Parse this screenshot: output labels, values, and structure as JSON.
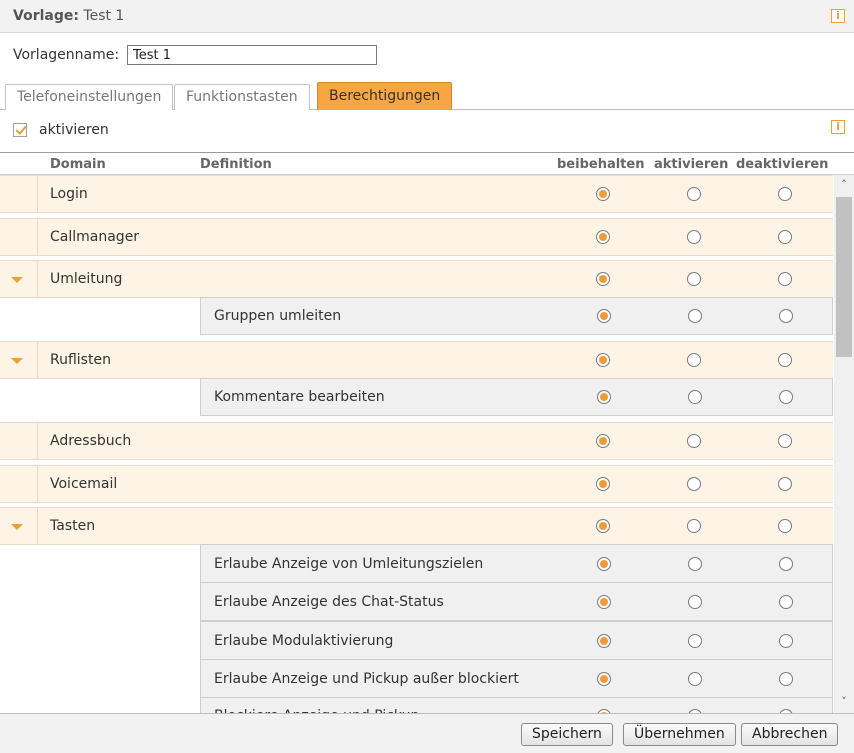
{
  "header": {
    "title_prefix": "Vorlage:",
    "title_value": "Test 1"
  },
  "form": {
    "name_label": "Vorlagenname:",
    "name_value": "Test 1"
  },
  "tabs": [
    {
      "label": "Telefoneinstellungen",
      "active": false
    },
    {
      "label": "Funktionstasten",
      "active": false
    },
    {
      "label": "Berechtigungen",
      "active": true
    }
  ],
  "activate": {
    "label": "aktivieren",
    "checked": true
  },
  "table": {
    "columns": {
      "domain": "Domain",
      "definition": "Definition",
      "keep": "beibehalten",
      "enable": "aktivieren",
      "disable": "deaktivieren"
    },
    "rows": [
      {
        "type": "parent",
        "label": "Login",
        "expandable": false,
        "selected": "keep"
      },
      {
        "type": "parent",
        "label": "Callmanager",
        "expandable": false,
        "selected": "keep"
      },
      {
        "type": "parent",
        "label": "Umleitung",
        "expandable": true,
        "selected": "keep"
      },
      {
        "type": "child",
        "label": "Gruppen umleiten",
        "selected": "keep"
      },
      {
        "type": "parent",
        "label": "Ruflisten",
        "expandable": true,
        "selected": "keep"
      },
      {
        "type": "child",
        "label": "Kommentare bearbeiten",
        "selected": "keep"
      },
      {
        "type": "parent",
        "label": "Adressbuch",
        "expandable": false,
        "selected": "keep"
      },
      {
        "type": "parent",
        "label": "Voicemail",
        "expandable": false,
        "selected": "keep"
      },
      {
        "type": "parent",
        "label": "Tasten",
        "expandable": true,
        "selected": "keep"
      },
      {
        "type": "child",
        "label": "Erlaube Anzeige von Umleitungszielen",
        "selected": "keep"
      },
      {
        "type": "child",
        "label": "Erlaube Anzeige des Chat-Status",
        "selected": "keep"
      },
      {
        "type": "child",
        "label": "Erlaube Modulaktivierung",
        "selected": "keep"
      },
      {
        "type": "child",
        "label": "Erlaube Anzeige und Pickup außer blockiert",
        "selected": "keep"
      },
      {
        "type": "child",
        "label": "Blockiere Anzeige und Pickup",
        "selected": "keep"
      }
    ]
  },
  "footer": {
    "save": "Speichern",
    "apply": "Übernehmen",
    "cancel": "Abbrechen"
  },
  "colors": {
    "accent": "#f7a643",
    "row_bg": "#fdf4e6",
    "child_bg": "#f0f0f0"
  },
  "icons": {
    "info": "info-icon",
    "expand": "triangle-down-icon"
  }
}
